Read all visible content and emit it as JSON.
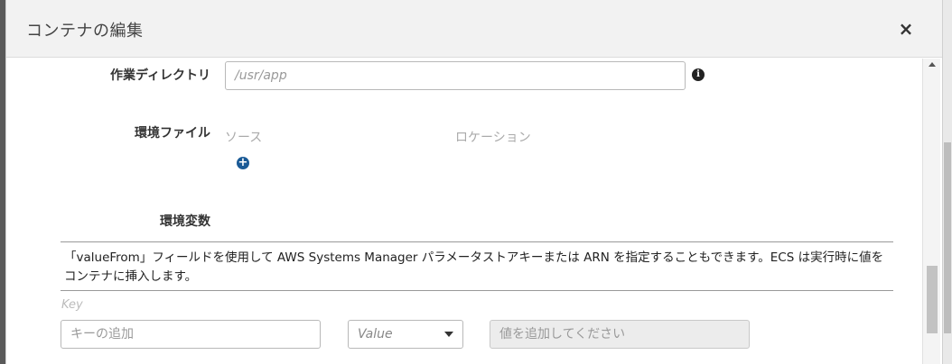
{
  "dialog": {
    "title": "コンテナの編集",
    "close_glyph": "×"
  },
  "working_directory": {
    "label": "作業ディレクトリ",
    "placeholder": "/usr/app",
    "info_glyph": "i"
  },
  "env_files": {
    "label": "環境ファイル",
    "col_source": "ソース",
    "col_location": "ロケーション",
    "add_glyph": "+"
  },
  "env_vars": {
    "label": "環境変数",
    "help_text": "「valueFrom」フィールドを使用して AWS Systems Manager パラメータストアキーまたは ARN を指定することもできます。ECS は実行時に値をコンテナに挿入します。",
    "key_header": "Key",
    "key_placeholder": "キーの追加",
    "value_type_selected": "Value",
    "value_placeholder": "値を追加してください"
  },
  "icons": {
    "close": "close-icon",
    "info": "info-icon",
    "add": "plus-circle-icon",
    "dropdown": "caret-down-icon",
    "scroll_up": "scroll-up-arrow-icon"
  },
  "colors": {
    "header_bg": "#f2f2f2",
    "add_icon": "#1a5a96",
    "disabled_input_bg": "#ececec"
  }
}
